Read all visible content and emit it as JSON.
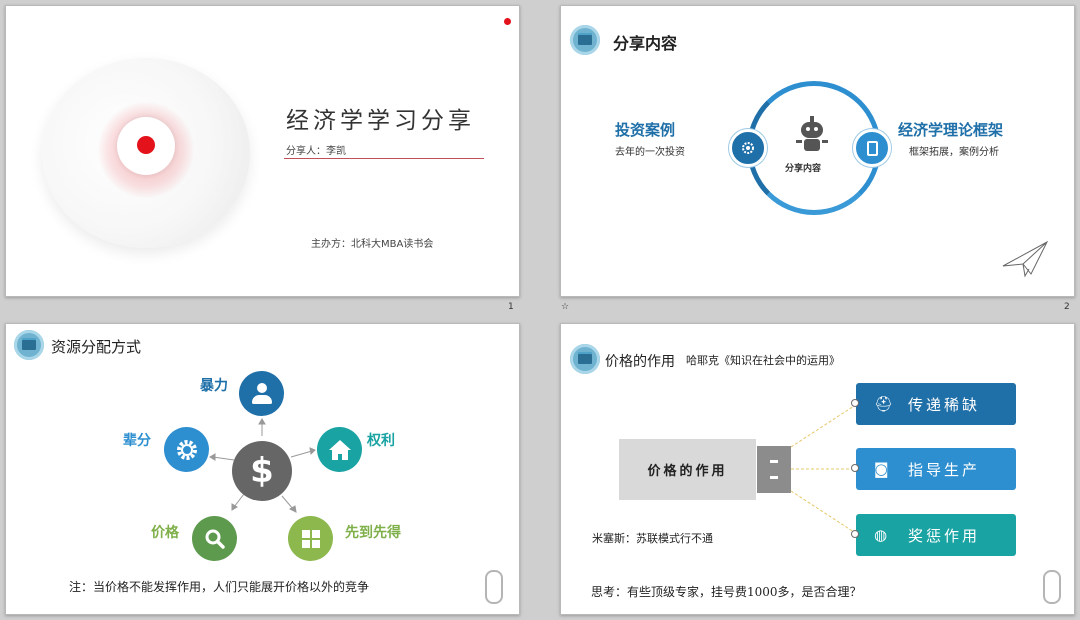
{
  "slide1": {
    "title": "经济学学习分享",
    "presenter": "分享人：李凯",
    "organizer": "主办方：北科大MBA读书会",
    "page_number": "1"
  },
  "slide2": {
    "header": "分享内容",
    "left_title": "投资案例",
    "left_sub": "去年的一次投资",
    "center_label": "分享内容",
    "right_title": "经济学理论框架",
    "right_sub": "框架拓展，案例分析",
    "page_number": "2",
    "side_mark": "☆"
  },
  "slide3": {
    "header": "资源分配方式",
    "items": {
      "violence": "暴力",
      "seniority": "辈分",
      "power": "权利",
      "price": "价格",
      "first_come": "先到先得"
    },
    "center_symbol": "$",
    "note": "注：当价格不能发挥作用，人们只能展开价格以外的竞争"
  },
  "slide4": {
    "header": "价格的作用",
    "subheader": "哈耶克《知识在社会中的运用》",
    "center_box": "价格的作用",
    "buttons": [
      "传递稀缺",
      "指导生产",
      "奖惩作用"
    ],
    "mises": "米塞斯：苏联模式行不通",
    "think": "思考：有些顶级专家，挂号费1000多，是否合理？"
  },
  "colors": {
    "blue_dark": "#1f6fa8",
    "blue_mid": "#2e8fd0",
    "teal": "#1aa3a3",
    "green": "#7fb04a",
    "gray_center": "#666666",
    "red_dot": "#e3121b"
  }
}
